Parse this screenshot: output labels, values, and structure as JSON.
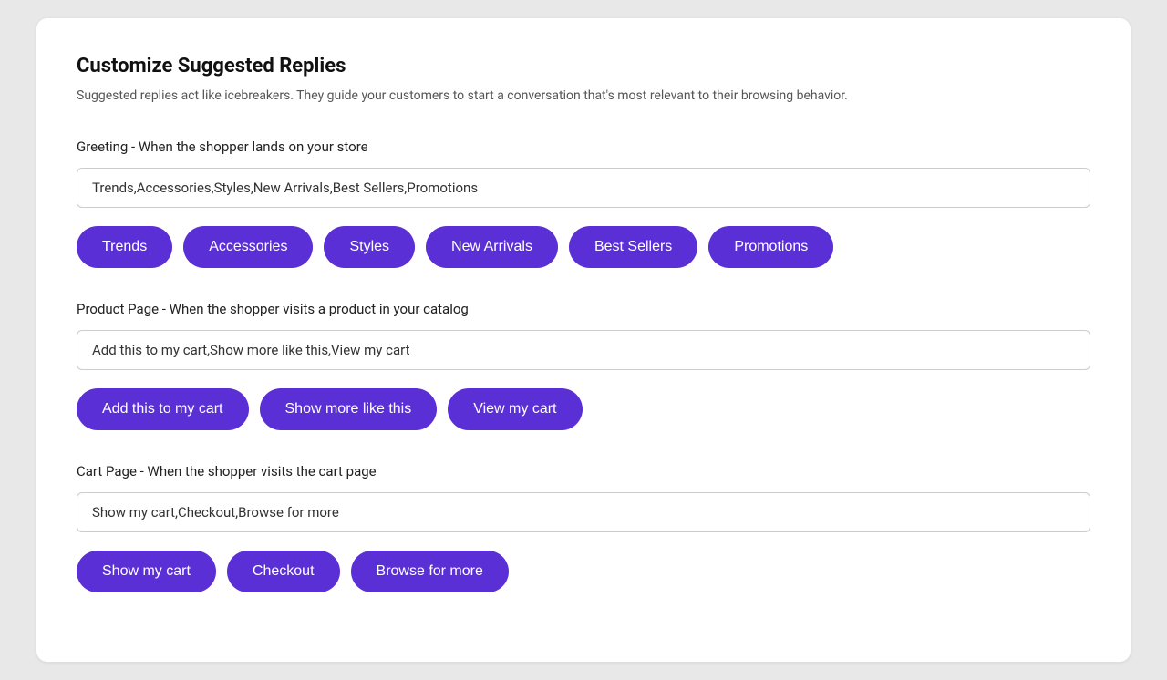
{
  "page": {
    "title": "Customize Suggested Replies",
    "description": "Suggested replies act like icebreakers. They guide your customers to start a conversation that's most relevant to their browsing behavior."
  },
  "sections": [
    {
      "id": "greeting",
      "label": "Greeting - When the shopper lands on your store",
      "input_value": "Trends,Accessories,Styles,New Arrivals,Best Sellers,Promotions",
      "pills": [
        "Trends",
        "Accessories",
        "Styles",
        "New Arrivals",
        "Best Sellers",
        "Promotions"
      ]
    },
    {
      "id": "product-page",
      "label": "Product Page - When the shopper visits a product in your catalog",
      "input_value": "Add this to my cart,Show more like this,View my cart",
      "pills": [
        "Add this to my cart",
        "Show more like this",
        "View my cart"
      ]
    },
    {
      "id": "cart-page",
      "label": "Cart Page - When the shopper visits the cart page",
      "input_value": "Show my cart,Checkout,Browse for more",
      "pills": [
        "Show my cart",
        "Checkout",
        "Browse for more"
      ]
    }
  ]
}
